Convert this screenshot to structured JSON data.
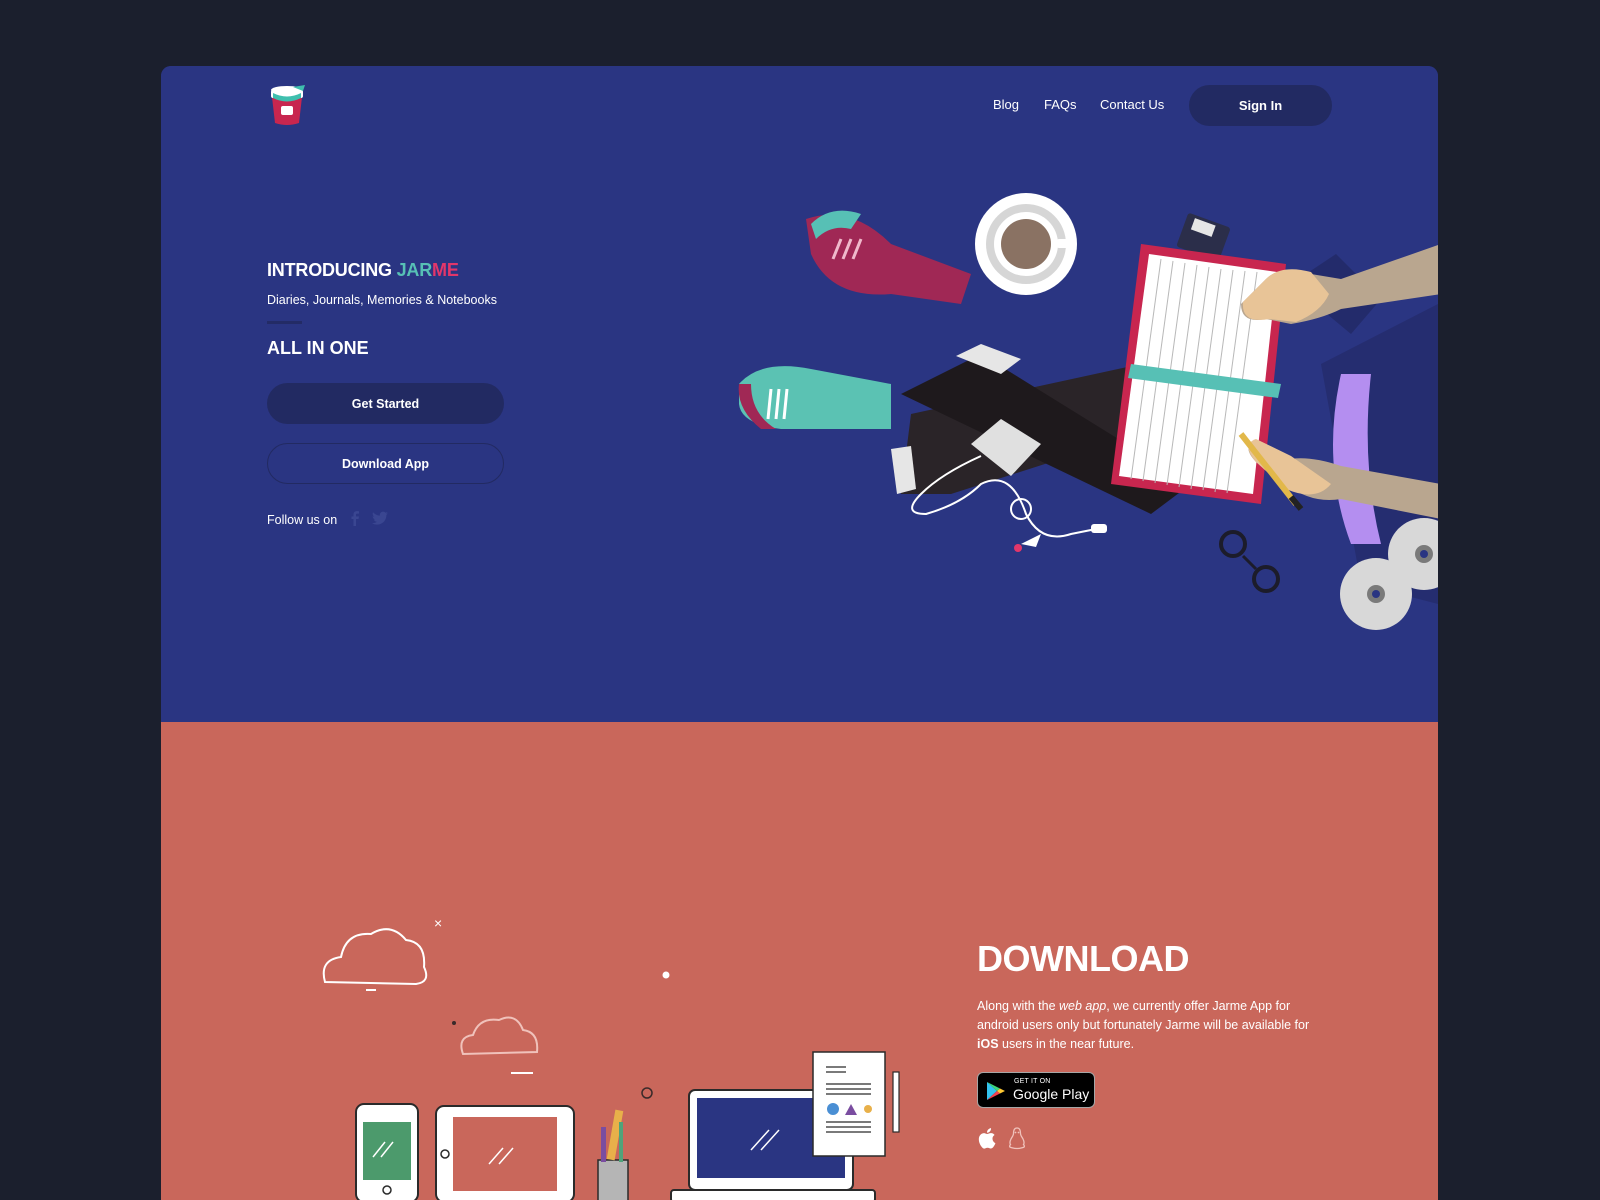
{
  "nav": {
    "logo_icon": "jar-logo-icon",
    "links": [
      {
        "label": "Blog"
      },
      {
        "label": "FAQs"
      },
      {
        "label": "Contact Us"
      }
    ],
    "signin_label": "Sign In"
  },
  "hero": {
    "title_prefix": "INTRODUCING ",
    "title_brand_a": "JAR",
    "title_brand_b": "ME",
    "subtitle": "Diaries, Journals, Memories & Notebooks",
    "tagline": "ALL IN ONE",
    "get_started_label": "Get Started",
    "download_label": "Download App",
    "follow_label": "Follow us on",
    "social_icons": [
      "facebook-icon",
      "twitter-icon"
    ],
    "illustration": "person-writing-in-notebook-illustration"
  },
  "download": {
    "title": "DOWNLOAD",
    "desc_1": "Along with the ",
    "desc_em": "web app",
    "desc_2": ", we currently offer Jarme App for android users only but fortunately Jarme will be available for ",
    "desc_strong": "iOS",
    "desc_3": " users in the near future.",
    "store_small": "GET IT ON",
    "store_big": "Google Play",
    "platform_icons": [
      "apple-icon",
      "linux-icon"
    ],
    "illustration": "devices-cloud-illustration"
  },
  "colors": {
    "page_bg": "#1b1f2d",
    "hero_bg": "#2a3582",
    "button_bg": "#222a62",
    "download_bg": "#c9675b",
    "brand_teal": "#57c0b5",
    "brand_pink": "#e2366a"
  }
}
